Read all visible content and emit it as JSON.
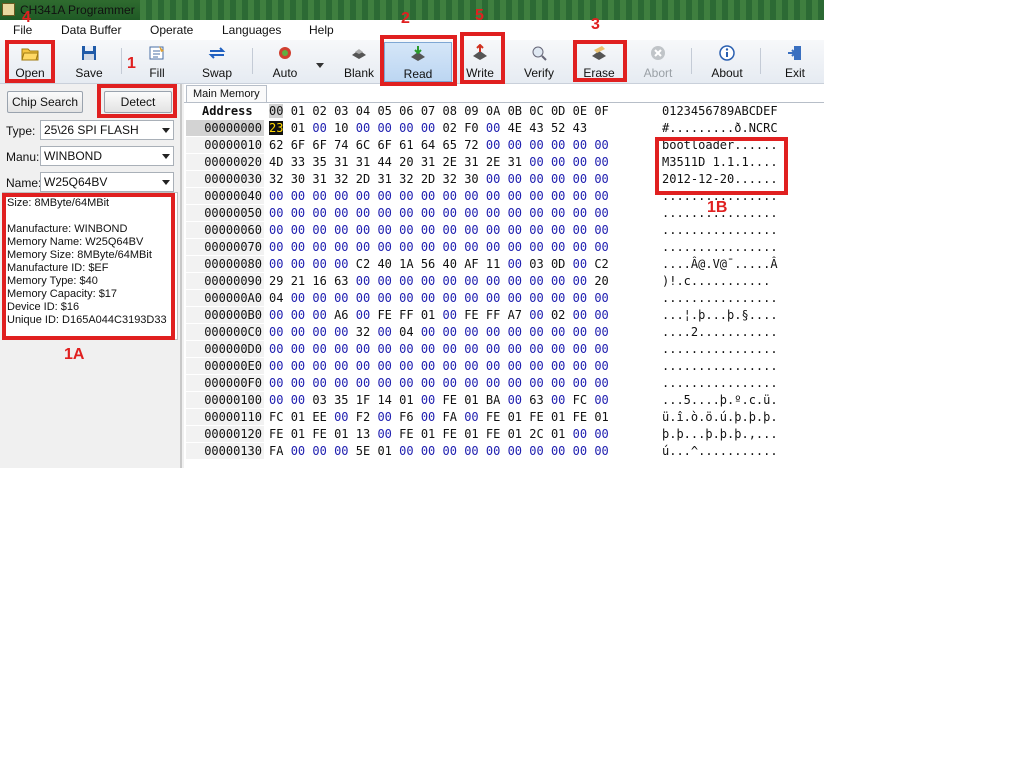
{
  "window": {
    "title": "CH341A Programmer"
  },
  "menu": [
    "File",
    "Data Buffer",
    "Operate",
    "Languages",
    "Help"
  ],
  "toolbar": {
    "buttons": [
      {
        "label": "Open",
        "icon": "folder-open-icon"
      },
      {
        "label": "Save",
        "icon": "floppy-disk-icon"
      },
      {
        "label": "Fill",
        "icon": "fill-icon"
      },
      {
        "label": "Swap",
        "icon": "swap-arrows-icon"
      },
      {
        "label": "Auto",
        "icon": "auto-gear-icon"
      },
      {
        "label": "Blank",
        "icon": "blank-chip-icon"
      },
      {
        "label": "Read",
        "icon": "read-chip-icon"
      },
      {
        "label": "Write",
        "icon": "write-chip-icon"
      },
      {
        "label": "Verify",
        "icon": "verify-magnifier-icon"
      },
      {
        "label": "Erase",
        "icon": "erase-chip-icon"
      },
      {
        "label": "Abort",
        "icon": "abort-x-icon"
      },
      {
        "label": "About",
        "icon": "info-icon"
      },
      {
        "label": "Exit",
        "icon": "exit-door-icon"
      }
    ]
  },
  "left": {
    "chip_search": "Chip Search",
    "detect": "Detect",
    "type_label": "Type:",
    "type_value": "25\\26 SPI FLASH",
    "manu_label": "Manu:",
    "manu_value": "WINBOND",
    "name_label": "Name:",
    "name_value": "W25Q64BV",
    "info": [
      "Size:   8MByte/64MBit",
      "",
      "Manufacture: WINBOND",
      "Memory Name: W25Q64BV",
      "Memory Size: 8MByte/64MBit",
      "Manufacture ID: $EF",
      "Memory Type: $40",
      "Memory Capacity: $17",
      "Device ID: $16",
      "Unique ID: D165A044C3193D33"
    ]
  },
  "main": {
    "tab": "Main Memory",
    "address_header": "Address",
    "columns": [
      "00",
      "01",
      "02",
      "03",
      "04",
      "05",
      "06",
      "07",
      "08",
      "09",
      "0A",
      "0B",
      "0C",
      "0D",
      "0E",
      "0F"
    ],
    "ascii_header": "0123456789ABCDEF",
    "rows": [
      {
        "addr": "00000000",
        "bytes": [
          "23",
          "01",
          "00",
          "10",
          "00",
          "00",
          "00",
          "00",
          "02",
          "F0",
          "00",
          "4E",
          "43",
          "52",
          "43"
        ],
        "ascii": "#.........ð.NCRC"
      },
      {
        "addr": "00000010",
        "bytes": [
          "62",
          "6F",
          "6F",
          "74",
          "6C",
          "6F",
          "61",
          "64",
          "65",
          "72",
          "00",
          "00",
          "00",
          "00",
          "00",
          "00"
        ],
        "ascii": "bootloader......"
      },
      {
        "addr": "00000020",
        "bytes": [
          "4D",
          "33",
          "35",
          "31",
          "31",
          "44",
          "20",
          "31",
          "2E",
          "31",
          "2E",
          "31",
          "00",
          "00",
          "00",
          "00"
        ],
        "ascii": "M3511D 1.1.1...."
      },
      {
        "addr": "00000030",
        "bytes": [
          "32",
          "30",
          "31",
          "32",
          "2D",
          "31",
          "32",
          "2D",
          "32",
          "30",
          "00",
          "00",
          "00",
          "00",
          "00",
          "00"
        ],
        "ascii": "2012-12-20......"
      },
      {
        "addr": "00000040",
        "bytes": [
          "00",
          "00",
          "00",
          "00",
          "00",
          "00",
          "00",
          "00",
          "00",
          "00",
          "00",
          "00",
          "00",
          "00",
          "00",
          "00"
        ],
        "ascii": "................"
      },
      {
        "addr": "00000050",
        "bytes": [
          "00",
          "00",
          "00",
          "00",
          "00",
          "00",
          "00",
          "00",
          "00",
          "00",
          "00",
          "00",
          "00",
          "00",
          "00",
          "00"
        ],
        "ascii": "................"
      },
      {
        "addr": "00000060",
        "bytes": [
          "00",
          "00",
          "00",
          "00",
          "00",
          "00",
          "00",
          "00",
          "00",
          "00",
          "00",
          "00",
          "00",
          "00",
          "00",
          "00"
        ],
        "ascii": "................"
      },
      {
        "addr": "00000070",
        "bytes": [
          "00",
          "00",
          "00",
          "00",
          "00",
          "00",
          "00",
          "00",
          "00",
          "00",
          "00",
          "00",
          "00",
          "00",
          "00",
          "00"
        ],
        "ascii": "................"
      },
      {
        "addr": "00000080",
        "bytes": [
          "00",
          "00",
          "00",
          "00",
          "C2",
          "40",
          "1A",
          "56",
          "40",
          "AF",
          "11",
          "00",
          "03",
          "0D",
          "00",
          "C2"
        ],
        "ascii": "....Â@.V@¯.....Â"
      },
      {
        "addr": "00000090",
        "bytes": [
          "29",
          "21",
          "16",
          "63",
          "00",
          "00",
          "00",
          "00",
          "00",
          "00",
          "00",
          "00",
          "00",
          "00",
          "00",
          "20"
        ],
        "ascii": ")!.c..........."
      },
      {
        "addr": "000000A0",
        "bytes": [
          "04",
          "00",
          "00",
          "00",
          "00",
          "00",
          "00",
          "00",
          "00",
          "00",
          "00",
          "00",
          "00",
          "00",
          "00",
          "00"
        ],
        "ascii": "................"
      },
      {
        "addr": "000000B0",
        "bytes": [
          "00",
          "00",
          "00",
          "A6",
          "00",
          "FE",
          "FF",
          "01",
          "00",
          "FE",
          "FF",
          "A7",
          "00",
          "02",
          "00",
          "00"
        ],
        "ascii": "...¦.þ...þ.§...."
      },
      {
        "addr": "000000C0",
        "bytes": [
          "00",
          "00",
          "00",
          "00",
          "32",
          "00",
          "04",
          "00",
          "00",
          "00",
          "00",
          "00",
          "00",
          "00",
          "00",
          "00"
        ],
        "ascii": "....2..........."
      },
      {
        "addr": "000000D0",
        "bytes": [
          "00",
          "00",
          "00",
          "00",
          "00",
          "00",
          "00",
          "00",
          "00",
          "00",
          "00",
          "00",
          "00",
          "00",
          "00",
          "00"
        ],
        "ascii": "................"
      },
      {
        "addr": "000000E0",
        "bytes": [
          "00",
          "00",
          "00",
          "00",
          "00",
          "00",
          "00",
          "00",
          "00",
          "00",
          "00",
          "00",
          "00",
          "00",
          "00",
          "00"
        ],
        "ascii": "................"
      },
      {
        "addr": "000000F0",
        "bytes": [
          "00",
          "00",
          "00",
          "00",
          "00",
          "00",
          "00",
          "00",
          "00",
          "00",
          "00",
          "00",
          "00",
          "00",
          "00",
          "00"
        ],
        "ascii": "................"
      },
      {
        "addr": "00000100",
        "bytes": [
          "00",
          "00",
          "03",
          "35",
          "1F",
          "14",
          "01",
          "00",
          "FE",
          "01",
          "BA",
          "00",
          "63",
          "00",
          "FC",
          "00"
        ],
        "ascii": "...5....þ.º.c.ü."
      },
      {
        "addr": "00000110",
        "bytes": [
          "FC",
          "01",
          "EE",
          "00",
          "F2",
          "00",
          "F6",
          "00",
          "FA",
          "00",
          "FE",
          "01",
          "FE",
          "01",
          "FE",
          "01"
        ],
        "ascii": "ü.î.ò.ö.ú.þ.þ.þ."
      },
      {
        "addr": "00000120",
        "bytes": [
          "FE",
          "01",
          "FE",
          "01",
          "13",
          "00",
          "FE",
          "01",
          "FE",
          "01",
          "FE",
          "01",
          "2C",
          "01",
          "00",
          "00"
        ],
        "ascii": "þ.þ...þ.þ.þ.,..."
      },
      {
        "addr": "00000130",
        "bytes": [
          "FA",
          "00",
          "00",
          "00",
          "5E",
          "01",
          "00",
          "00",
          "00",
          "00",
          "00",
          "00",
          "00",
          "00",
          "00",
          "00"
        ],
        "ascii": "ú...^..........."
      }
    ]
  },
  "annotations": {
    "n1": "1",
    "n2": "2",
    "n3": "3",
    "n4": "4",
    "n5": "5",
    "n1a": "1A",
    "n1b": "1B",
    "color": "#e02020"
  }
}
